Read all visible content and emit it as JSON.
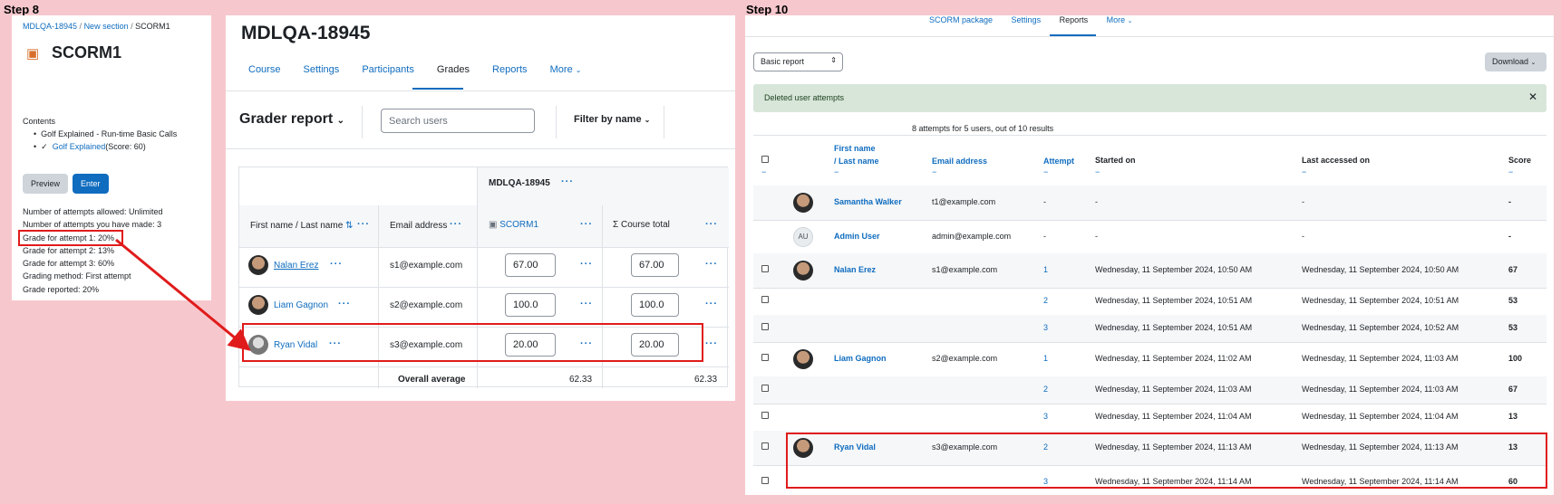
{
  "steps": {
    "left": "Step 8",
    "right": "Step 10"
  },
  "scorm": {
    "breadcrumb": [
      "MDLQA-18945",
      "New section",
      "SCORM1"
    ],
    "title": "SCORM1",
    "contents_label": "Contents",
    "items": [
      "Golf Explained - Run-time Basic Calls",
      "Golf Explained"
    ],
    "score_text": "(Score: 60)",
    "preview": "Preview",
    "enter": "Enter",
    "info": [
      "Number of attempts allowed: Unlimited",
      "Number of attempts you have made: 3",
      "Grade for attempt 1: 20%",
      "Grade for attempt 2: 13%",
      "Grade for attempt 3: 60%",
      "Grading method: First attempt",
      "Grade reported: 20%"
    ]
  },
  "grader": {
    "course": "MDLQA-18945",
    "tabs": [
      "Course",
      "Settings",
      "Participants",
      "Grades",
      "Reports",
      "More"
    ],
    "report_title": "Grader report",
    "search_placeholder": "Search users",
    "filter": "Filter by name",
    "category": "MDLQA-18945",
    "col_name": "First name / Last name",
    "col_email": "Email address",
    "col_scorm": "SCORM1",
    "col_total": "Course total",
    "rows": [
      {
        "name": "Nalan Erez",
        "email": "s1@example.com",
        "scorm": "67.00",
        "total": "67.00"
      },
      {
        "name": "Liam Gagnon",
        "email": "s2@example.com",
        "scorm": "100.0",
        "total": "100.0"
      },
      {
        "name": "Ryan Vidal",
        "email": "s3@example.com",
        "scorm": "20.00",
        "total": "20.00"
      }
    ],
    "avg_label": "Overall average",
    "avg_scorm": "62.33",
    "avg_total": "62.33"
  },
  "report": {
    "tabs": [
      "SCORM package",
      "Settings",
      "Reports",
      "More"
    ],
    "select": "Basic report",
    "download": "Download",
    "alert": "Deleted user attempts",
    "summary": "8 attempts for 5 users, out of 10 results",
    "headers": {
      "first": "First name",
      "last": "/ Last name",
      "email": "Email address",
      "attempt": "Attempt",
      "started": "Started on",
      "accessed": "Last accessed on",
      "score": "Score"
    },
    "rows": [
      {
        "name": "Samantha Walker",
        "email": "t1@example.com",
        "attempt": "-",
        "started": "-",
        "accessed": "-",
        "score": "-"
      },
      {
        "name": "Admin User",
        "email": "admin@example.com",
        "attempt": "-",
        "started": "-",
        "accessed": "-",
        "score": "-",
        "initials": "AU"
      },
      {
        "name": "Nalan Erez",
        "email": "s1@example.com",
        "attempt": "1",
        "started": "Wednesday, 11 September 2024, 10:50 AM",
        "accessed": "Wednesday, 11 September 2024, 10:50 AM",
        "score": "67"
      },
      {
        "name": "",
        "email": "",
        "attempt": "2",
        "started": "Wednesday, 11 September 2024, 10:51 AM",
        "accessed": "Wednesday, 11 September 2024, 10:51 AM",
        "score": "53"
      },
      {
        "name": "",
        "email": "",
        "attempt": "3",
        "started": "Wednesday, 11 September 2024, 10:51 AM",
        "accessed": "Wednesday, 11 September 2024, 10:52 AM",
        "score": "53"
      },
      {
        "name": "Liam Gagnon",
        "email": "s2@example.com",
        "attempt": "1",
        "started": "Wednesday, 11 September 2024, 11:02 AM",
        "accessed": "Wednesday, 11 September 2024, 11:03 AM",
        "score": "100"
      },
      {
        "name": "",
        "email": "",
        "attempt": "2",
        "started": "Wednesday, 11 September 2024, 11:03 AM",
        "accessed": "Wednesday, 11 September 2024, 11:03 AM",
        "score": "67"
      },
      {
        "name": "",
        "email": "",
        "attempt": "3",
        "started": "Wednesday, 11 September 2024, 11:04 AM",
        "accessed": "Wednesday, 11 September 2024, 11:04 AM",
        "score": "13"
      },
      {
        "name": "Ryan Vidal",
        "email": "s3@example.com",
        "attempt": "2",
        "started": "Wednesday, 11 September 2024, 11:13 AM",
        "accessed": "Wednesday, 11 September 2024, 11:13 AM",
        "score": "13"
      },
      {
        "name": "",
        "email": "",
        "attempt": "3",
        "started": "Wednesday, 11 September 2024, 11:14 AM",
        "accessed": "Wednesday, 11 September 2024, 11:14 AM",
        "score": "60"
      }
    ]
  }
}
